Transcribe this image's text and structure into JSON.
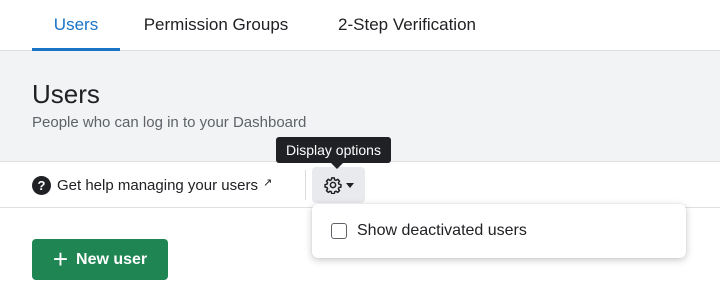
{
  "tabs": [
    {
      "label": "Users",
      "active": true
    },
    {
      "label": "Permission Groups",
      "active": false
    },
    {
      "label": "2-Step Verification",
      "active": false
    }
  ],
  "header": {
    "title": "Users",
    "subtitle": "People who can log in to your Dashboard"
  },
  "toolbar": {
    "help_label": "Get help managing your users",
    "help_icon": "question-circle-icon",
    "external_icon": "external-link-icon",
    "display_options_icon": "gear-icon"
  },
  "tooltip": {
    "text": "Display options"
  },
  "menu": {
    "items": [
      {
        "label": "Show deactivated users",
        "checked": false
      }
    ]
  },
  "actions": {
    "new_user_label": "New user"
  },
  "colors": {
    "accent": "#1a73c6",
    "primary_button": "#1e8553",
    "header_background": "#f1f3f4",
    "tooltip_background": "#202124"
  }
}
